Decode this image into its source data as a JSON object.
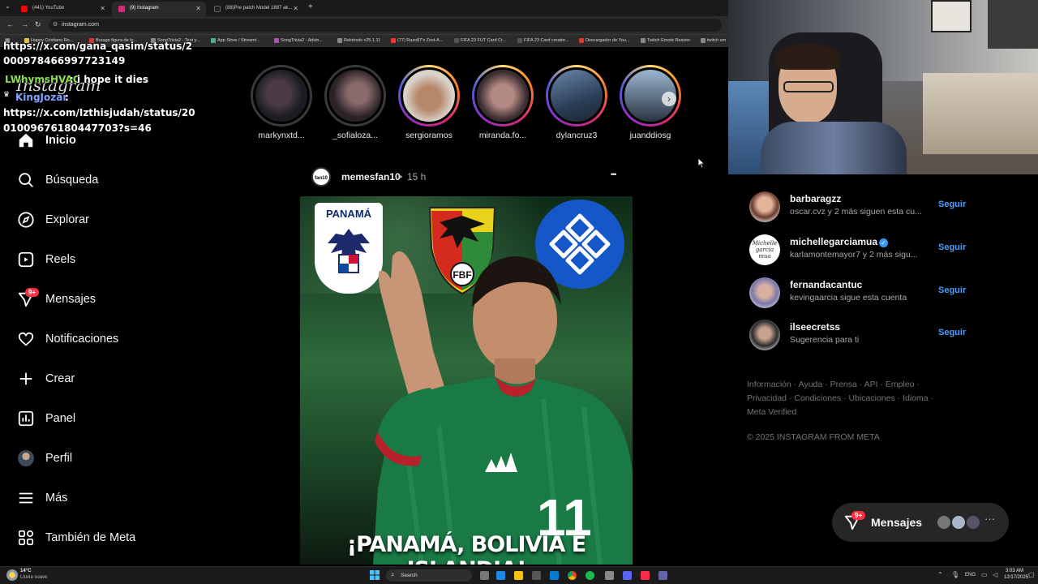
{
  "browser": {
    "tabs": [
      {
        "label": "(441) YouTube",
        "active": false,
        "color": "#ff0000"
      },
      {
        "label": "(9) Instagram",
        "active": true,
        "color": "#d62976"
      },
      {
        "label": "(88)Pre patch Model 1887 ak...",
        "active": false,
        "color": "#111111"
      }
    ],
    "new_tab": "+",
    "url": "instagram.com",
    "bookmarks": [
      "Happy Cristiano Ro...",
      "Burago figura de lo...",
      "SongTrivia2 - Test y...",
      "App Store / Streami...",
      "SongTrivia2 - Advin...",
      "Relotools v25.1.11",
      "(77) Razo87's Zest-A...",
      "FIFA 23 FUT Card Cr...",
      "FIFA 23 Card creator...",
      "Descargador de You...",
      "Twitch Emote Resizer",
      "twitch em"
    ]
  },
  "chat": [
    {
      "text": "https://x.com/gana_qasim/status/2",
      "color": "#ffffff"
    },
    {
      "text": "000978466997723149",
      "color": "#ffffff"
    },
    {
      "text": "LWhymsHVAC",
      "color": "#8be04e"
    },
    {
      "text": ": i hope it dies",
      "color": "#ffffff"
    },
    {
      "text": "KingJozar",
      "color": "#7fa6ff"
    },
    {
      "text": ":",
      "color": "#ffffff"
    },
    {
      "text": "https://x.com/Izthisjudah/status/20",
      "color": "#ffffff"
    },
    {
      "text": "01009676180447703?s=46",
      "color": "#ffffff"
    }
  ],
  "logo": "Instagram",
  "sidebar": {
    "items": [
      {
        "label": "Inicio",
        "icon": "home-icon"
      },
      {
        "label": "Búsqueda",
        "icon": "search-icon"
      },
      {
        "label": "Explorar",
        "icon": "compass-icon"
      },
      {
        "label": "Reels",
        "icon": "reels-icon"
      },
      {
        "label": "Mensajes",
        "icon": "messenger-icon",
        "badge": "9+"
      },
      {
        "label": "Notificaciones",
        "icon": "heart-icon"
      },
      {
        "label": "Crear",
        "icon": "plus-icon"
      },
      {
        "label": "Panel",
        "icon": "dashboard-icon"
      },
      {
        "label": "Perfil",
        "icon": "profile-avatar-icon"
      },
      {
        "label": "Más",
        "icon": "menu-icon"
      },
      {
        "label": "También de Meta",
        "icon": "meta-apps-icon"
      }
    ]
  },
  "stories": [
    {
      "name": "markynxtd...",
      "seen": true
    },
    {
      "name": "_sofialoza...",
      "seen": true
    },
    {
      "name": "sergioramos",
      "seen": false
    },
    {
      "name": "miranda.fo...",
      "seen": false
    },
    {
      "name": "dylancruz3",
      "seen": false
    },
    {
      "name": "juanddiosg",
      "seen": false
    }
  ],
  "post": {
    "author": "memesfan10",
    "avatar_text": "fan10",
    "separator": "•",
    "time": "15 h",
    "more": "•••",
    "badge_panama": "PANAMÁ",
    "bolivia_crest": "FBF",
    "caption": "¡PANAMÁ, BOLIVIA E ISLANDIA!",
    "jersey_number": "11"
  },
  "suggestions": [
    {
      "name": "barbaragzz",
      "sub": "oscar.cvz y 2 más siguen esta cu...",
      "follow": "Seguir",
      "verified": false
    },
    {
      "name": "michellegarciamua",
      "sub": "karlamontemayor7 y 2 más sigu...",
      "follow": "Seguir",
      "verified": true,
      "avatar_text": "Michelle garcia mua"
    },
    {
      "name": "fernandacantuc",
      "sub": "kevingaarcia sigue esta cuenta",
      "follow": "Seguir",
      "verified": false
    },
    {
      "name": "ilseecretss",
      "sub": "Sugerencia para ti",
      "follow": "Seguir",
      "verified": false
    }
  ],
  "footer": {
    "links_line1": [
      "Información",
      "Ayuda",
      "Prensa",
      "API",
      "Empleo"
    ],
    "links_line2": [
      "Privacidad",
      "Condiciones",
      "Ubicaciones",
      "Idioma"
    ],
    "links_line3": [
      "Meta Verified"
    ],
    "copyright": "© 2025 INSTAGRAM FROM META"
  },
  "messages_pill": {
    "label": "Mensajes",
    "badge": "9+"
  },
  "taskbar": {
    "weather_temp": "14°C",
    "weather_desc": "Lluvia suave",
    "search": "Search",
    "lang": "ENG",
    "time": "3:03 AM",
    "date": "12/17/2025"
  },
  "colors": {
    "accent_blue": "#4a9eff",
    "notification_red": "#ff3040",
    "background": "#000000"
  }
}
